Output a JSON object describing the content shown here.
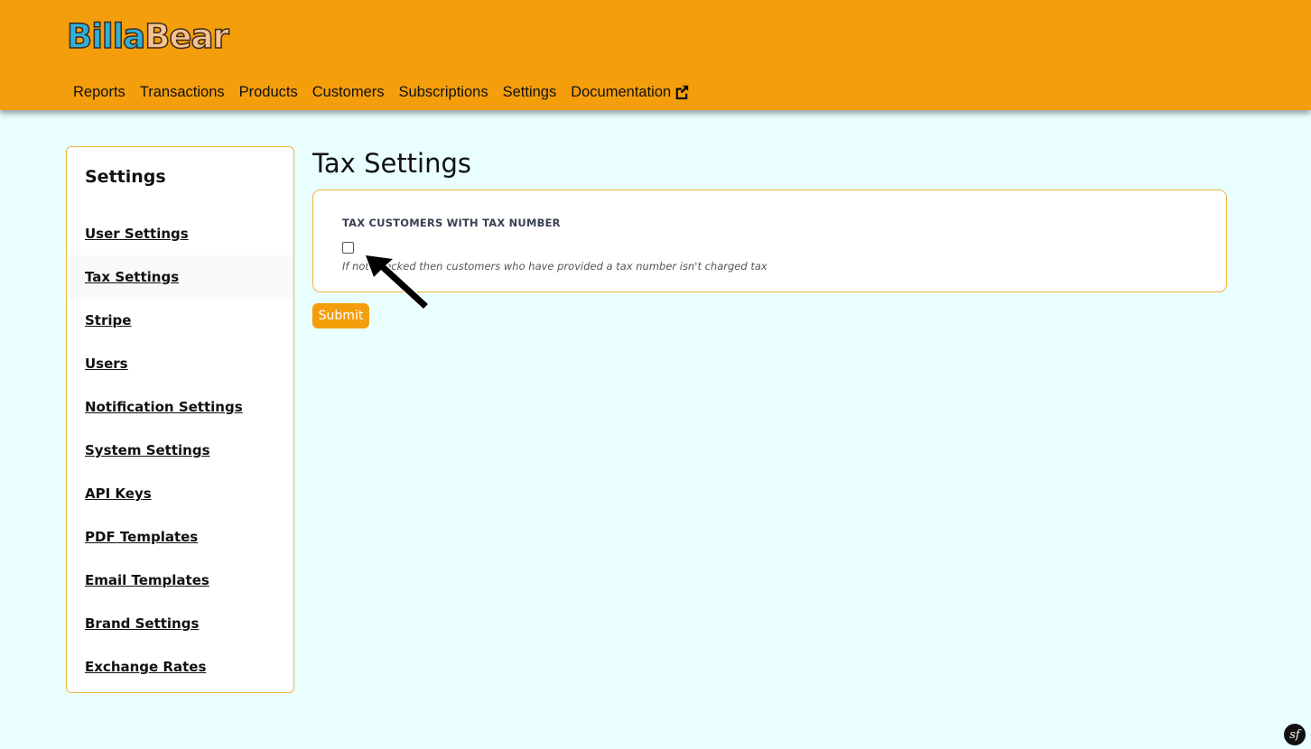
{
  "brand": {
    "part1": "Billa",
    "part2": "Bear"
  },
  "nav": {
    "items": [
      {
        "label": "Reports"
      },
      {
        "label": "Transactions"
      },
      {
        "label": "Products"
      },
      {
        "label": "Customers"
      },
      {
        "label": "Subscriptions"
      },
      {
        "label": "Settings"
      },
      {
        "label": "Documentation",
        "icon": "external-link-icon"
      }
    ]
  },
  "sidebar": {
    "title": "Settings",
    "active_index": 1,
    "items": [
      {
        "label": "User Settings"
      },
      {
        "label": "Tax Settings"
      },
      {
        "label": "Stripe"
      },
      {
        "label": "Users"
      },
      {
        "label": "Notification Settings"
      },
      {
        "label": "System Settings"
      },
      {
        "label": "API Keys"
      },
      {
        "label": "PDF Templates"
      },
      {
        "label": "Email Templates"
      },
      {
        "label": "Brand Settings"
      },
      {
        "label": "Exchange Rates"
      }
    ]
  },
  "main": {
    "title": "Tax Settings",
    "field": {
      "label": "TAX CUSTOMERS WITH TAX NUMBER",
      "checked": false,
      "help": "If not checked then customers who have provided a tax number isn't charged tax"
    },
    "submit_label": "Submit"
  },
  "colors": {
    "header_bg": "#f59e0b",
    "page_bg": "#e9feff",
    "border_accent": "#f0b43a"
  },
  "icons": {
    "cursor": "arrow-cursor-icon",
    "corner": "symfony-icon",
    "corner_text": "sf"
  }
}
